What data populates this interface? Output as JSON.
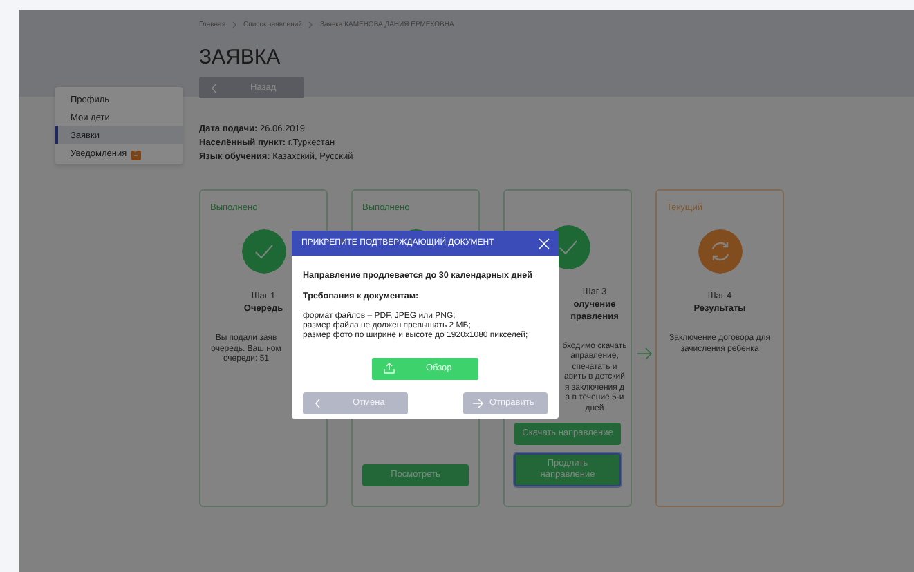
{
  "breadcrumb": [
    "Главная",
    "Список заявлений",
    "Заявка КАМЕНОВА ДАНИЯ ЕРМЕКОВНА"
  ],
  "title": "ЗАЯВКА",
  "back_button": "Назад",
  "sidebar": {
    "items": [
      {
        "label": "Профиль",
        "selected": false
      },
      {
        "label": "Мои дети",
        "selected": false
      },
      {
        "label": "Заявки",
        "selected": true
      },
      {
        "label": "Уведомления",
        "selected": false,
        "badge": "1"
      }
    ]
  },
  "details": [
    {
      "label": "Дата подачи:",
      "value": "26.06.2019"
    },
    {
      "label": "Населённый пункт:",
      "value": "г.Туркестан"
    },
    {
      "label": "Язык обучения:",
      "value": "Казахский, Русский"
    }
  ],
  "steps": [
    {
      "kind": "done",
      "status": "Выполнено",
      "step": "Шаг 1",
      "title_lines": [
        "Очередь"
      ],
      "description_lines": [
        "Вы подали заяв",
        "очередь. Ваш ном",
        "очереди: 51"
      ]
    },
    {
      "kind": "done",
      "status": "Выполнено",
      "buttons": [
        {
          "label": "Посмотреть",
          "focused": false
        }
      ]
    },
    {
      "kind": "done",
      "step": "Шаг 3",
      "title_lines": [
        "олучение",
        "правления"
      ],
      "description_lines": [
        "бходимо скачать",
        "аправление,",
        "спечатать и",
        "авить в детский",
        "я заключения д",
        "а в течение 5-и",
        "дней"
      ],
      "buttons": [
        {
          "label": "Скачать направление",
          "focused": false
        },
        {
          "label": "Продлить направление",
          "focused": true
        }
      ]
    },
    {
      "kind": "current",
      "status": "Текущий",
      "step": "Шаг 4",
      "title_lines": [
        "Результаты"
      ],
      "description": "Заключение договора для зачисления ребенка"
    }
  ],
  "modal": {
    "title": "ПРИКРЕПИТЕ ПОДТВЕРЖДАЮЩИЙ ДОКУМЕНТ",
    "notice": "Направление продлевается до 30 календарных дней",
    "requirements_heading": "Требования к документам:",
    "requirements": [
      "формат файлов – PDF, JPEG или PNG;",
      "размер файла не должен превышать 2 МБ;",
      "размер фото по ширине и высоте до 1920x1080 пикселей;"
    ],
    "browse_button": "Обзор",
    "cancel_button": "Отмена",
    "submit_button": "Отправить"
  }
}
